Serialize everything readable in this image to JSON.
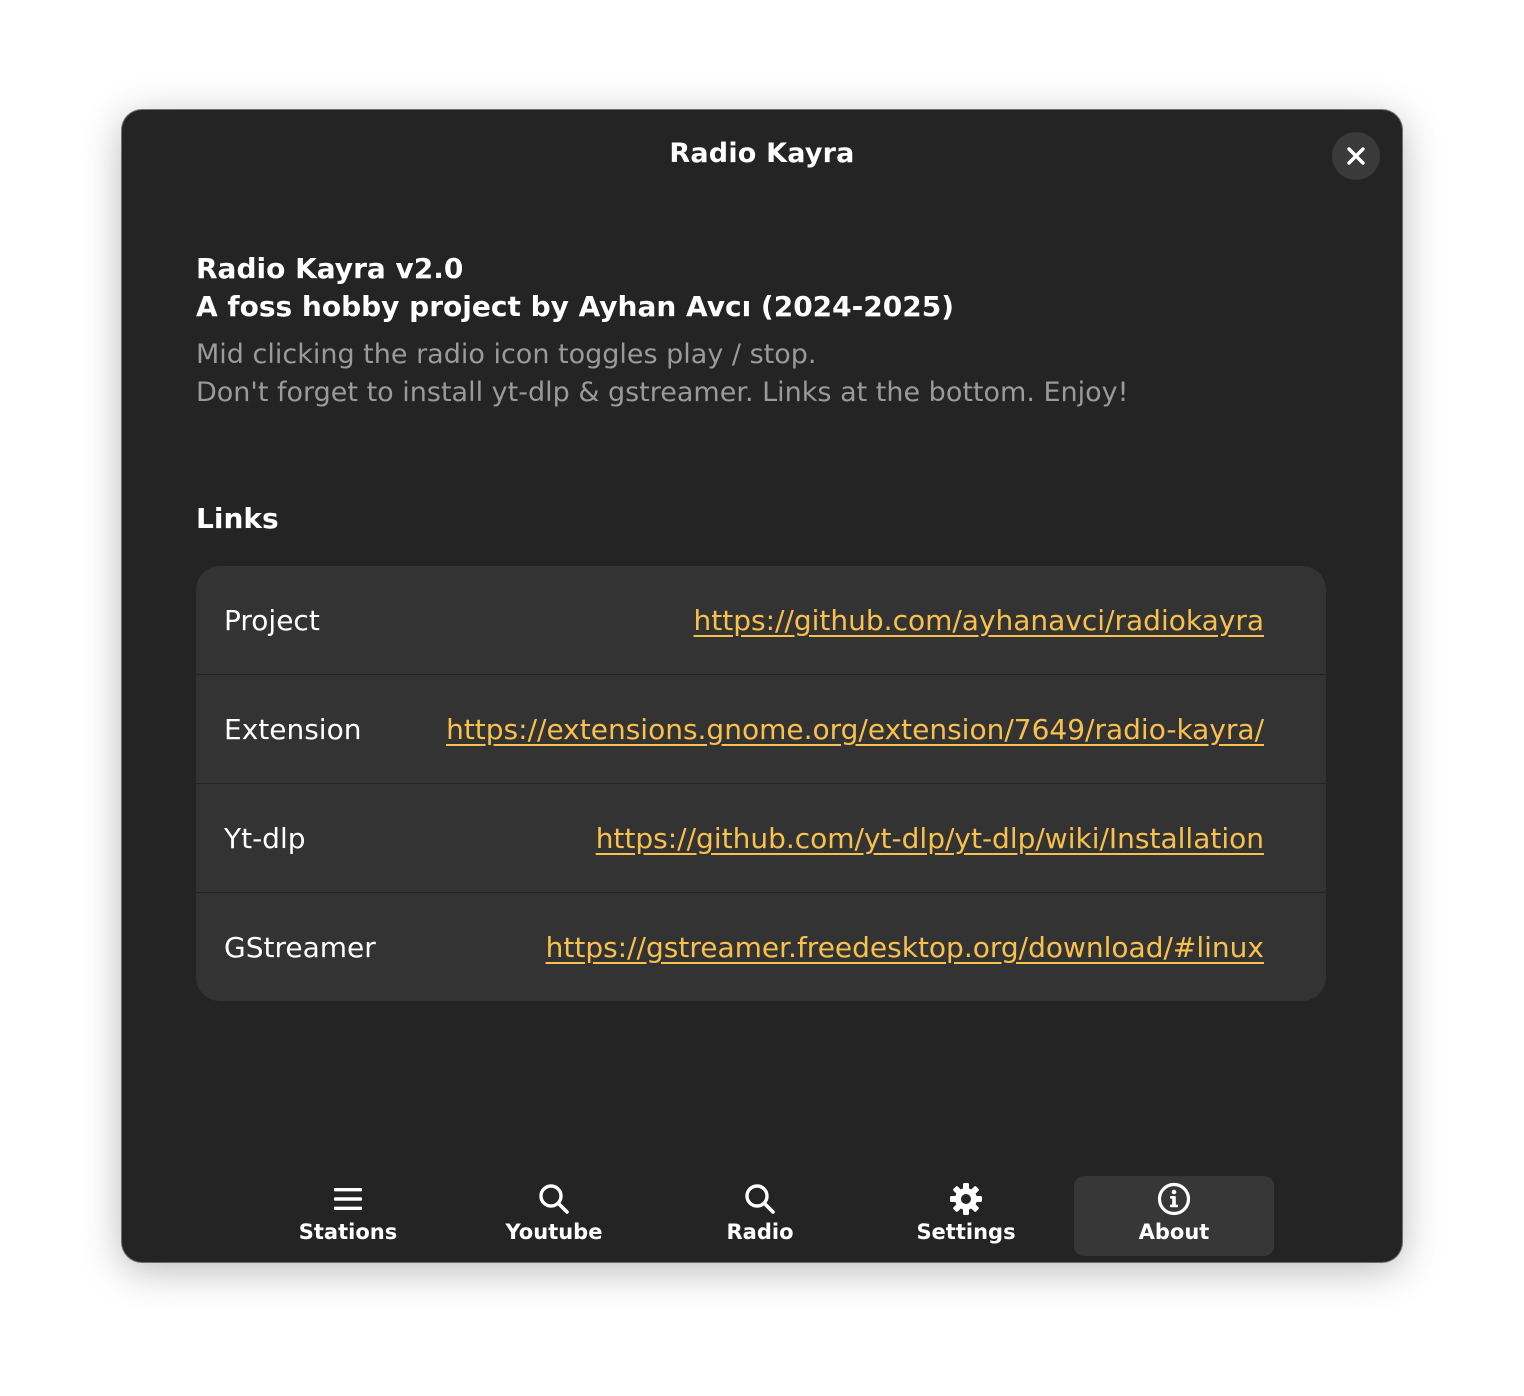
{
  "window": {
    "title": "Radio Kayra"
  },
  "about": {
    "heading_line1": "Radio Kayra v2.0",
    "heading_line2": "A foss hobby project by Ayhan Avcı (2024-2025)",
    "desc_line1": "Mid clicking the radio icon toggles play / stop.",
    "desc_line2": "Don't forget to install yt-dlp & gstreamer. Links at the bottom. Enjoy!"
  },
  "links": {
    "title": "Links",
    "items": [
      {
        "label": "Project",
        "url": "https://github.com/ayhanavci/radiokayra"
      },
      {
        "label": "Extension",
        "url": "https://extensions.gnome.org/extension/7649/radio-kayra/"
      },
      {
        "label": "Yt-dlp",
        "url": "https://github.com/yt-dlp/yt-dlp/wiki/Installation"
      },
      {
        "label": "GStreamer",
        "url": "https://gstreamer.freedesktop.org/download/#linux"
      }
    ]
  },
  "tabs": [
    {
      "label": "Stations",
      "icon": "list-icon",
      "active": false
    },
    {
      "label": "Youtube",
      "icon": "search-icon",
      "active": false
    },
    {
      "label": "Radio",
      "icon": "search-icon",
      "active": false
    },
    {
      "label": "Settings",
      "icon": "gear-icon",
      "active": false
    },
    {
      "label": "About",
      "icon": "info-icon",
      "active": true
    }
  ],
  "colors": {
    "window_bg": "#242424",
    "card_bg": "#333333",
    "link": "#f8c04d",
    "muted_text": "#9a9a9a"
  }
}
